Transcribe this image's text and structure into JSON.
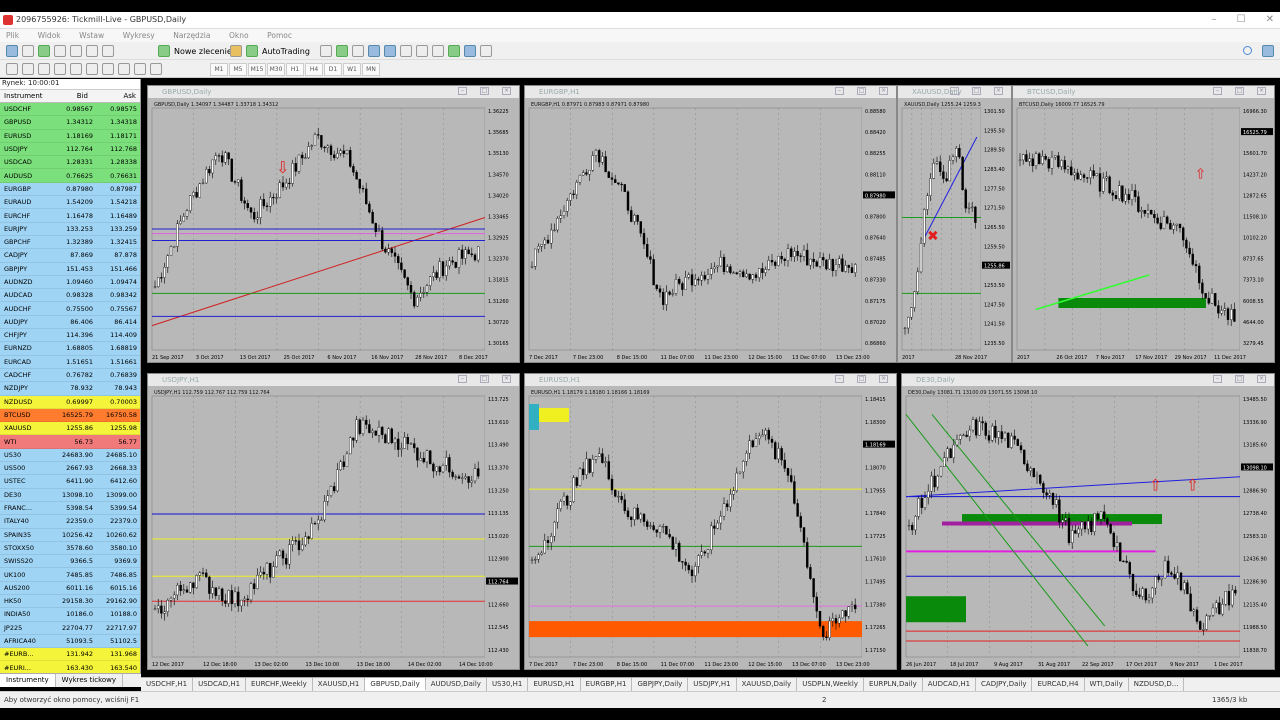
{
  "window": {
    "title": "2096755926: Tickmill-Live - GBPUSD,Daily",
    "min": "–",
    "max": "☐",
    "close": "✕"
  },
  "menu": [
    "Plik",
    "Widok",
    "Wstaw",
    "Wykresy",
    "Narzędzia",
    "Okno",
    "Pomoc"
  ],
  "toolbar": {
    "new_order": "Nowe zlecenie",
    "autotrading": "AutoTrading"
  },
  "timeframes": [
    "M1",
    "M5",
    "M15",
    "M30",
    "H1",
    "H4",
    "D1",
    "W1",
    "MN"
  ],
  "market_watch": {
    "header": "Rynek: 10:00:01",
    "cols": [
      "Instrument",
      "Bid",
      "Ask"
    ],
    "rows": [
      {
        "s": "USDCHF",
        "bid": "0.98567",
        "ask": "0.98575",
        "bg": "#7be07b"
      },
      {
        "s": "GBPUSD",
        "bid": "1.34312",
        "ask": "1.34318",
        "bg": "#7be07b"
      },
      {
        "s": "EURUSD",
        "bid": "1.18169",
        "ask": "1.18171",
        "bg": "#7be07b"
      },
      {
        "s": "USDJPY",
        "bid": "112.764",
        "ask": "112.768",
        "bg": "#7be07b"
      },
      {
        "s": "USDCAD",
        "bid": "1.28331",
        "ask": "1.28338",
        "bg": "#7be07b"
      },
      {
        "s": "AUDUSD",
        "bid": "0.76625",
        "ask": "0.76631",
        "bg": "#7be07b"
      },
      {
        "s": "EURGBP",
        "bid": "0.87980",
        "ask": "0.87987",
        "bg": "#9fd4f5"
      },
      {
        "s": "EURAUD",
        "bid": "1.54209",
        "ask": "1.54218",
        "bg": "#9fd4f5"
      },
      {
        "s": "EURCHF",
        "bid": "1.16478",
        "ask": "1.16489",
        "bg": "#9fd4f5"
      },
      {
        "s": "EURJPY",
        "bid": "133.253",
        "ask": "133.259",
        "bg": "#9fd4f5"
      },
      {
        "s": "GBPCHF",
        "bid": "1.32389",
        "ask": "1.32415",
        "bg": "#9fd4f5"
      },
      {
        "s": "CADJPY",
        "bid": "87.869",
        "ask": "87.878",
        "bg": "#9fd4f5"
      },
      {
        "s": "GBPJPY",
        "bid": "151.453",
        "ask": "151.466",
        "bg": "#9fd4f5"
      },
      {
        "s": "AUDNZD",
        "bid": "1.09460",
        "ask": "1.09474",
        "bg": "#9fd4f5"
      },
      {
        "s": "AUDCAD",
        "bid": "0.98328",
        "ask": "0.98342",
        "bg": "#9fd4f5"
      },
      {
        "s": "AUDCHF",
        "bid": "0.75500",
        "ask": "0.75567",
        "bg": "#9fd4f5"
      },
      {
        "s": "AUDJPY",
        "bid": "86.406",
        "ask": "86.414",
        "bg": "#9fd4f5"
      },
      {
        "s": "CHFJPY",
        "bid": "114.396",
        "ask": "114.409",
        "bg": "#9fd4f5"
      },
      {
        "s": "EURNZD",
        "bid": "1.68805",
        "ask": "1.68819",
        "bg": "#9fd4f5"
      },
      {
        "s": "EURCAD",
        "bid": "1.51651",
        "ask": "1.51661",
        "bg": "#9fd4f5"
      },
      {
        "s": "CADCHF",
        "bid": "0.76782",
        "ask": "0.76839",
        "bg": "#9fd4f5"
      },
      {
        "s": "NZDJPY",
        "bid": "78.932",
        "ask": "78.943",
        "bg": "#9fd4f5"
      },
      {
        "s": "NZDUSD",
        "bid": "0.69997",
        "ask": "0.70003",
        "bg": "#f4f43a"
      },
      {
        "s": "BTCUSD",
        "bid": "16525.79",
        "ask": "16750.58",
        "bg": "#ff7b2e"
      },
      {
        "s": "XAUUSD",
        "bid": "1255.86",
        "ask": "1255.98",
        "bg": "#f4f43a"
      },
      {
        "s": "WTI",
        "bid": "56.73",
        "ask": "56.77",
        "bg": "#f07a7a"
      },
      {
        "s": "US30",
        "bid": "24683.90",
        "ask": "24685.10",
        "bg": "#9fd4f5"
      },
      {
        "s": "US500",
        "bid": "2667.93",
        "ask": "2668.33",
        "bg": "#9fd4f5"
      },
      {
        "s": "USTEC",
        "bid": "6411.90",
        "ask": "6412.60",
        "bg": "#9fd4f5"
      },
      {
        "s": "DE30",
        "bid": "13098.10",
        "ask": "13099.00",
        "bg": "#9fd4f5"
      },
      {
        "s": "FRANC...",
        "bid": "5398.54",
        "ask": "5399.54",
        "bg": "#9fd4f5"
      },
      {
        "s": "ITALY40",
        "bid": "22359.0",
        "ask": "22379.0",
        "bg": "#9fd4f5"
      },
      {
        "s": "SPAIN35",
        "bid": "10256.42",
        "ask": "10260.62",
        "bg": "#9fd4f5"
      },
      {
        "s": "STOXX50",
        "bid": "3578.60",
        "ask": "3580.10",
        "bg": "#9fd4f5"
      },
      {
        "s": "SWISS20",
        "bid": "9366.5",
        "ask": "9369.9",
        "bg": "#9fd4f5"
      },
      {
        "s": "UK100",
        "bid": "7485.85",
        "ask": "7486.85",
        "bg": "#9fd4f5"
      },
      {
        "s": "AUS200",
        "bid": "6011.16",
        "ask": "6015.16",
        "bg": "#9fd4f5"
      },
      {
        "s": "HK50",
        "bid": "29158.30",
        "ask": "29162.90",
        "bg": "#9fd4f5"
      },
      {
        "s": "INDIA50",
        "bid": "10186.0",
        "ask": "10188.0",
        "bg": "#9fd4f5"
      },
      {
        "s": "JP225",
        "bid": "22704.77",
        "ask": "22717.97",
        "bg": "#9fd4f5"
      },
      {
        "s": "AFRICA40",
        "bid": "51093.5",
        "ask": "51102.5",
        "bg": "#9fd4f5"
      },
      {
        "s": "#EURB...",
        "bid": "131.942",
        "ask": "131.968",
        "bg": "#f4f43a"
      },
      {
        "s": "#EURI...",
        "bid": "163.430",
        "ask": "163.540",
        "bg": "#f4f43a"
      }
    ],
    "tabs": [
      "Instrumenty",
      "Wykres tickowy"
    ]
  },
  "charts": [
    {
      "title": "GBPUSD,Daily",
      "info": "GBPUSD,Daily  1.34097 1.34487 1.33718 1.34312",
      "prices": [
        "1.36225",
        "1.35685",
        "1.35130",
        "1.34570",
        "1.34020",
        "1.33465",
        "1.32925",
        "1.32370",
        "1.31815",
        "1.31260",
        "1.30720",
        "1.30165"
      ],
      "dates": [
        "21 Sep 2017",
        "3 Oct 2017",
        "13 Oct 2017",
        "25 Oct 2017",
        "6 Nov 2017",
        "16 Nov 2017",
        "28 Nov 2017",
        "8 Dec 2017"
      ],
      "last": "1.34312"
    },
    {
      "title": "EURGBP,H1",
      "info": "EURGBP,H1  0.87971 0.87983 0.87971 0.87980",
      "prices": [
        "0.88580",
        "0.88420",
        "0.88255",
        "0.88110",
        "0.87980",
        "0.87800",
        "0.87640",
        "0.87485",
        "0.87330",
        "0.87175",
        "0.87020",
        "0.86860"
      ],
      "dates": [
        "7 Dec 2017",
        "7 Dec 23:00",
        "8 Dec 15:00",
        "11 Dec 07:00",
        "11 Dec 23:00",
        "12 Dec 15:00",
        "13 Dec 07:00",
        "13 Dec 23:00"
      ],
      "last": "0.87980"
    },
    {
      "title": "XAUUSD,Daily",
      "info": "XAUUSD,Daily  1255.24 1259.3",
      "prices": [
        "1301.50",
        "1295.50",
        "1289.50",
        "1283.40",
        "1277.50",
        "1271.50",
        "1265.50",
        "1259.50",
        "1255.86",
        "1253.50",
        "1247.50",
        "1241.50",
        "1235.50"
      ],
      "dates": [
        "2017",
        "28 Nov 2017"
      ],
      "last": "1255.86"
    },
    {
      "title": "BTCUSD,Daily",
      "info": "BTCUSD,Daily  16009.77 16525.79",
      "prices": [
        "16966.30",
        "16525.79",
        "15601.70",
        "14237.20",
        "12872.65",
        "11508.10",
        "10102.20",
        "8737.65",
        "7373.10",
        "6008.55",
        "4644.00",
        "3279.45"
      ],
      "dates": [
        "2017",
        "26 Oct 2017",
        "7 Nov 2017",
        "17 Nov 2017",
        "29 Nov 2017",
        "11 Dec 2017"
      ],
      "last": "16525.79"
    },
    {
      "title": "USDJPY,H1",
      "info": "USDJPY,H1  112.759 112.767 112.759 112.764",
      "prices": [
        "113.725",
        "113.610",
        "113.490",
        "113.370",
        "113.250",
        "113.135",
        "113.020",
        "112.900",
        "112.764",
        "112.660",
        "112.545",
        "112.430"
      ],
      "dates": [
        "12 Dec 2017",
        "12 Dec 18:00",
        "13 Dec 02:00",
        "13 Dec 10:00",
        "13 Dec 18:00",
        "14 Dec 02:00",
        "14 Dec 10:00"
      ],
      "last": "112.764"
    },
    {
      "title": "EURUSD,H1",
      "info": "EURUSD,H1  1.18179 1.18180 1.18166 1.18169",
      "prices": [
        "1.18415",
        "1.18300",
        "1.18169",
        "1.18070",
        "1.17955",
        "1.17840",
        "1.17725",
        "1.17610",
        "1.17495",
        "1.17380",
        "1.17265",
        "1.17150"
      ],
      "dates": [
        "7 Dec 2017",
        "7 Dec 23:00",
        "8 Dec 15:00",
        "11 Dec 07:00",
        "11 Dec 23:00",
        "12 Dec 15:00",
        "13 Dec 07:00",
        "13 Dec 23:00"
      ],
      "last": "1.18169"
    },
    {
      "title": "DE30,Daily",
      "info": "DE30,Daily  13081.71 13100.09 13071.55 13098.10",
      "prices": [
        "13485.50",
        "13336.90",
        "13185.60",
        "13098.10",
        "12886.90",
        "12738.40",
        "12583.10",
        "12436.90",
        "12286.90",
        "12135.40",
        "11988.50",
        "11838.70"
      ],
      "dates": [
        "26 Jun 2017",
        "18 Jul 2017",
        "9 Aug 2017",
        "31 Aug 2017",
        "22 Sep 2017",
        "17 Oct 2017",
        "9 Nov 2017",
        "1 Dec 2017"
      ],
      "last": "13098.10"
    }
  ],
  "bottom_tabs": [
    "USDCHF,H1",
    "USDCAD,H1",
    "EURCHF,Weekly",
    "XAUUSD,H1",
    "GBPUSD,Daily",
    "AUDUSD,Daily",
    "US30,H1",
    "EURUSD,H1",
    "EURGBP,H1",
    "GBPJPY,Daily",
    "USDJPY,H1",
    "XAUUSD,Daily",
    "USDPLN,Weekly",
    "EURPLN,Daily",
    "AUDCAD,H1",
    "CADJPY,Daily",
    "EURCAD,H4",
    "WTI,Daily",
    "NZDUSD,D..."
  ],
  "status": {
    "help": "Aby otworzyć okno pomocy, wciśnij F1",
    "page": "2",
    "traffic": "1365/3 kb"
  },
  "colors": {
    "chart_bg": "#b8b8b8",
    "up": "#ffffff",
    "down": "#000000",
    "red": "#e02020",
    "blue": "#1010d0",
    "green": "#1a9a1a",
    "yellow": "#f0f020",
    "magenta": "#e020e0",
    "orange": "#ff5a00"
  }
}
